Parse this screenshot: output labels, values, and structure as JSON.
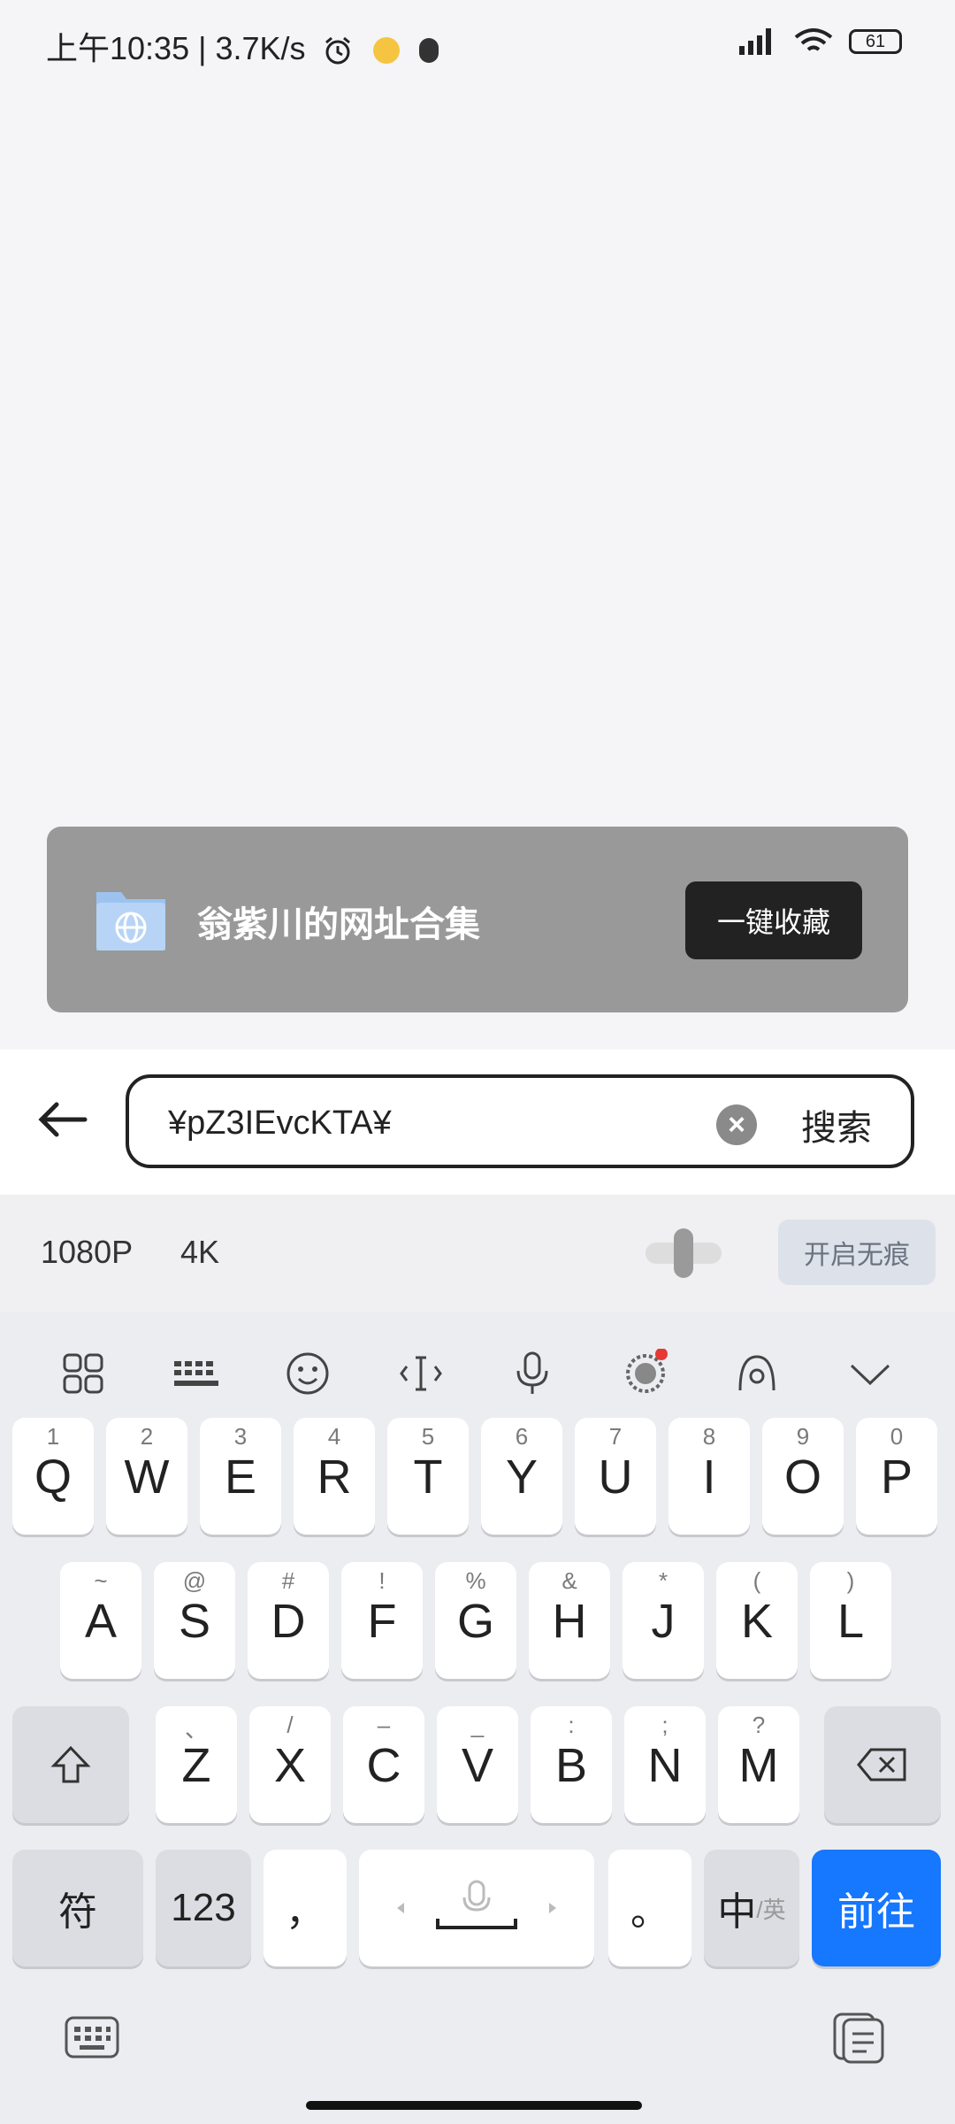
{
  "status_bar": {
    "time": "上午10:35",
    "speed": "3.7K/s",
    "battery": "61"
  },
  "banner": {
    "title": "翁紫川的网址合集",
    "button": "一键收藏"
  },
  "search": {
    "value": "¥pZ3IEvcKTA¥",
    "button": "搜索"
  },
  "toolbar": {
    "res1": "1080P",
    "res2": "4K",
    "incognito": "开启无痕"
  },
  "keyboard": {
    "row1": [
      {
        "hint": "1",
        "key": "Q"
      },
      {
        "hint": "2",
        "key": "W"
      },
      {
        "hint": "3",
        "key": "E"
      },
      {
        "hint": "4",
        "key": "R"
      },
      {
        "hint": "5",
        "key": "T"
      },
      {
        "hint": "6",
        "key": "Y"
      },
      {
        "hint": "7",
        "key": "U"
      },
      {
        "hint": "8",
        "key": "I"
      },
      {
        "hint": "9",
        "key": "O"
      },
      {
        "hint": "0",
        "key": "P"
      }
    ],
    "row2": [
      {
        "hint": "~",
        "key": "A"
      },
      {
        "hint": "@",
        "key": "S"
      },
      {
        "hint": "#",
        "key": "D"
      },
      {
        "hint": "!",
        "key": "F"
      },
      {
        "hint": "%",
        "key": "G"
      },
      {
        "hint": "&",
        "key": "H"
      },
      {
        "hint": "*",
        "key": "J"
      },
      {
        "hint": "(",
        "key": "K"
      },
      {
        "hint": ")",
        "key": "L"
      }
    ],
    "row3": [
      {
        "hint": "、",
        "key": "Z"
      },
      {
        "hint": "/",
        "key": "X"
      },
      {
        "hint": "–",
        "key": "C"
      },
      {
        "hint": "_",
        "key": "V"
      },
      {
        "hint": ":",
        "key": "B"
      },
      {
        "hint": ";",
        "key": "N"
      },
      {
        "hint": "?",
        "key": "M"
      }
    ],
    "symbols": "符",
    "numbers": "123",
    "comma": "，",
    "period": "。",
    "lang_main": "中",
    "lang_sub": "/英",
    "go": "前往"
  },
  "colors": {
    "accent": "#1677ff",
    "banner_bg": "#999999"
  }
}
